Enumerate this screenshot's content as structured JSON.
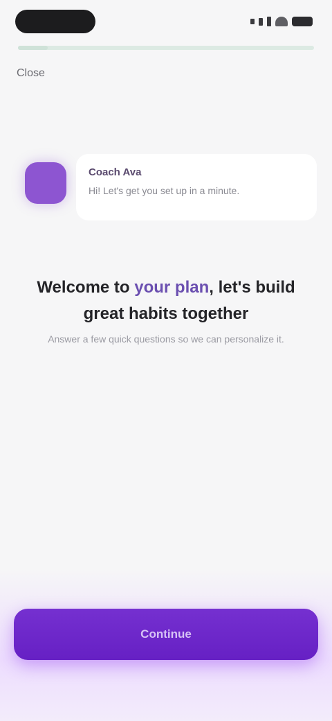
{
  "progress": {
    "value": 0.1
  },
  "nav": {
    "close_label": "Close"
  },
  "message": {
    "sender": "Coach Ava",
    "text": "Hi! Let's get you set up in a minute."
  },
  "headline": {
    "before": "Welcome to ",
    "accent": "your plan",
    "after": ", let's build great habits together"
  },
  "subtitle": "Answer a few quick questions so we can personalize it.",
  "cta": {
    "label": "Continue"
  },
  "colors": {
    "accent": "#6a22c8",
    "avatar": "#8d55d1"
  }
}
